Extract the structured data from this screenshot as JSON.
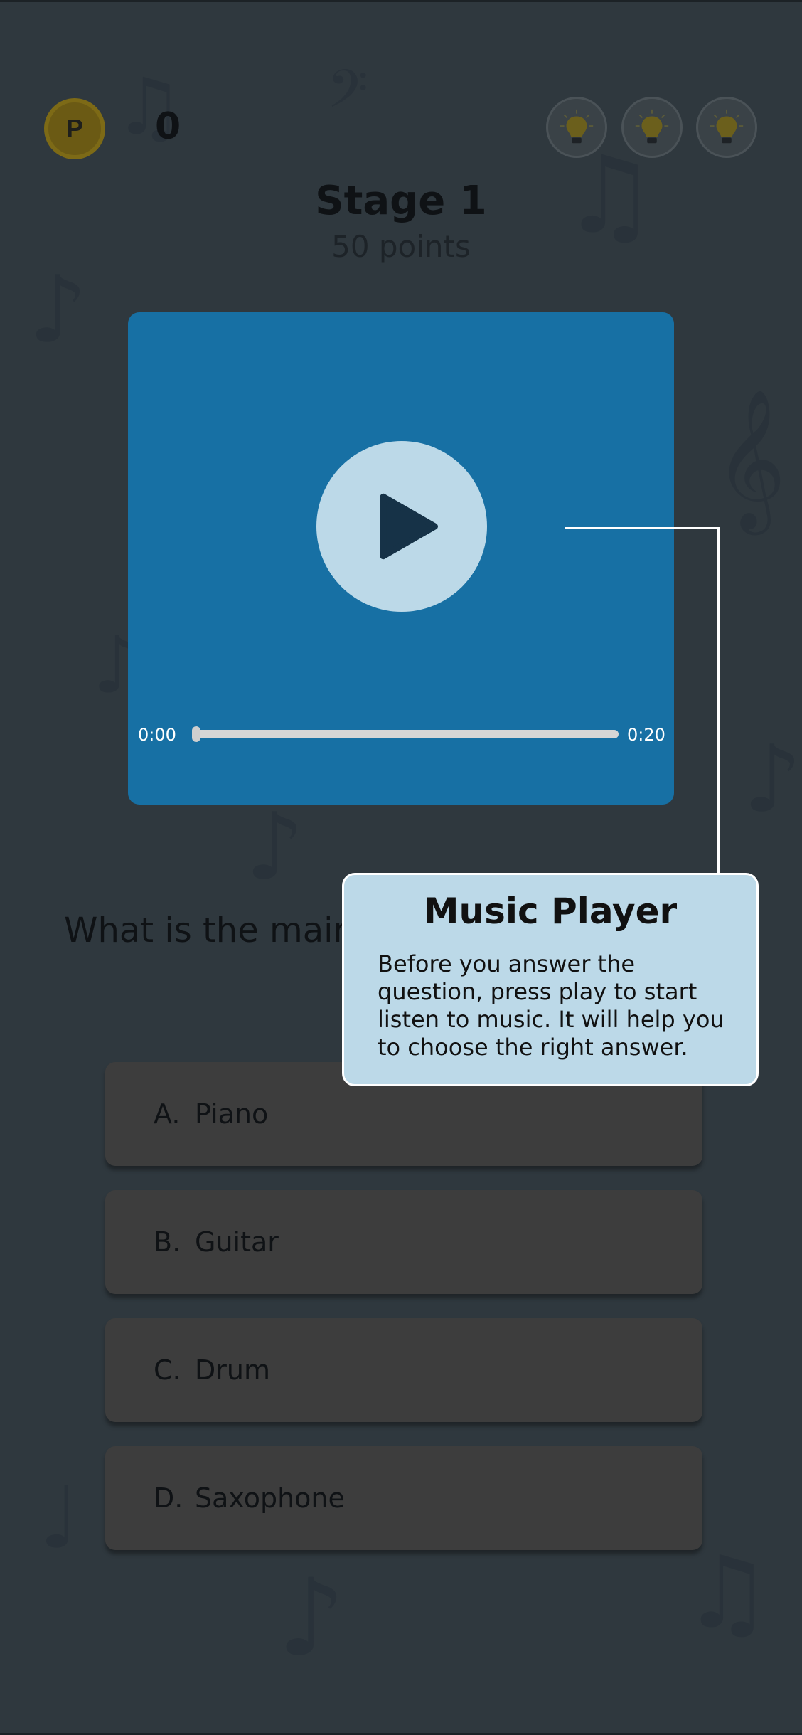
{
  "header": {
    "coin_letter": "P",
    "score": "0",
    "hint_count": 3,
    "hint_icon": "lightbulb-icon"
  },
  "stage": {
    "title": "Stage 1",
    "points": "50 points"
  },
  "player": {
    "current_time": "0:00",
    "total_time": "0:20",
    "progress": 0,
    "play_icon": "play-icon",
    "background_color": "#1770a4"
  },
  "question": {
    "text": "What is the main"
  },
  "tooltip": {
    "title": "Music Player",
    "body": "Before you answer the question, press play to start listen to music. It will help you to choose the right answer."
  },
  "answers": [
    {
      "letter": "A.",
      "label": "Piano"
    },
    {
      "letter": "B.",
      "label": "Guitar"
    },
    {
      "letter": "C.",
      "label": "Drum"
    },
    {
      "letter": "D.",
      "label": "Saxophone"
    }
  ],
  "colors": {
    "overlay_background": "#2f383e",
    "tooltip_background": "#bcd9e8",
    "coin": "#6b5a14"
  }
}
